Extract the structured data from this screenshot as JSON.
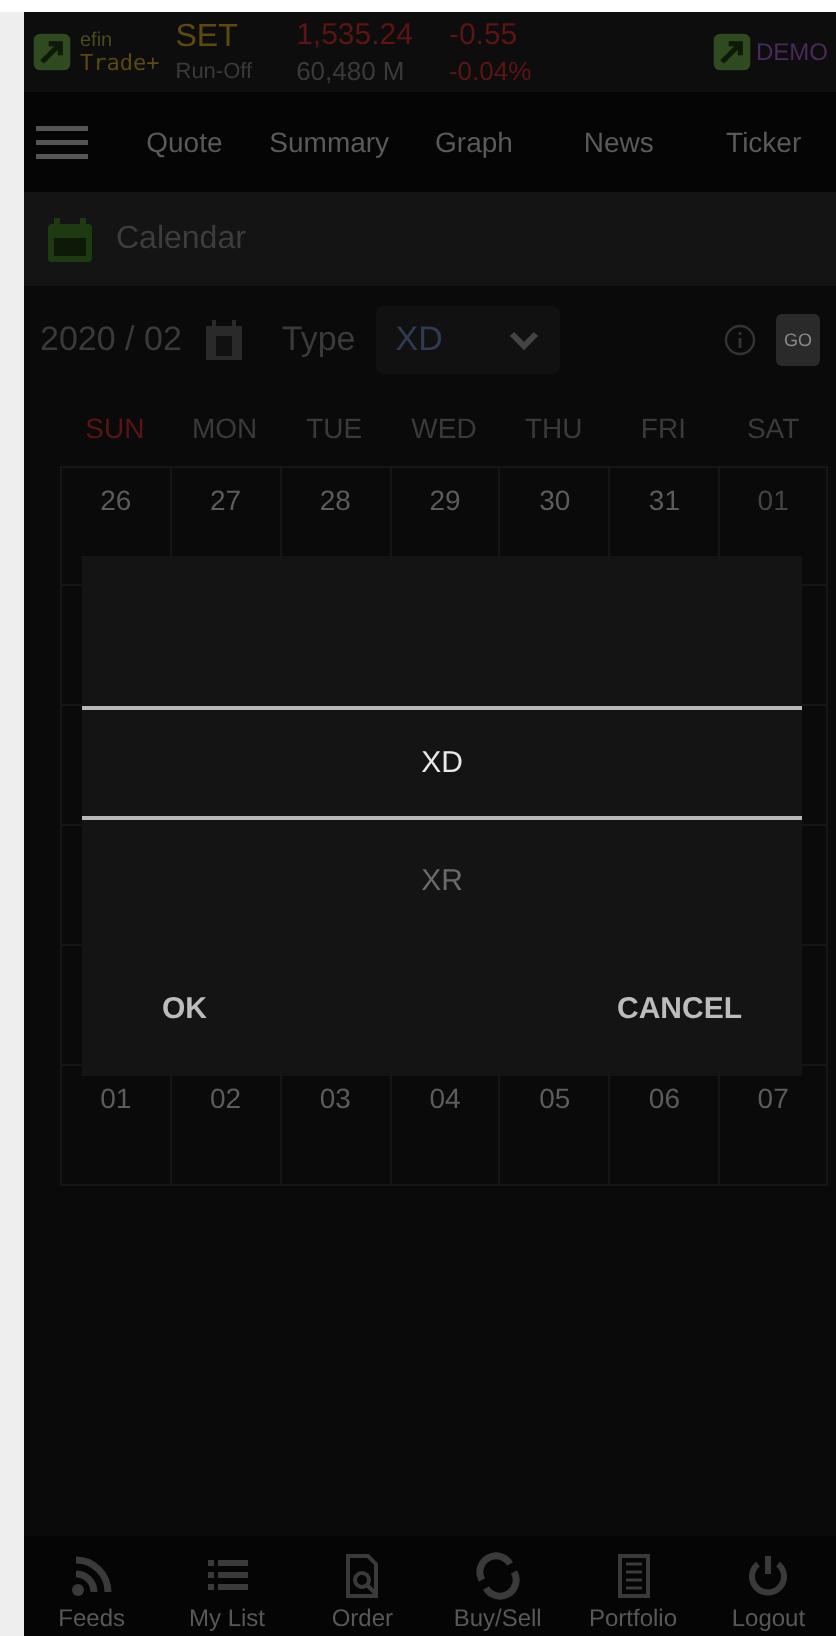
{
  "header": {
    "logo_top": "efin",
    "logo_bottom": "Trade+",
    "index": "SET",
    "value": "1,535.24",
    "change": "-0.55",
    "label": "Run-Off",
    "volume": "60,480 M",
    "percent": "-0.04%",
    "account": "DEMO"
  },
  "tabs": [
    {
      "label": "Quote",
      "selected": false
    },
    {
      "label": "Summary",
      "selected": false
    },
    {
      "label": "Graph",
      "selected": false
    },
    {
      "label": "News",
      "selected": false
    },
    {
      "label": "Ticker",
      "selected": false
    }
  ],
  "page_title": "Calendar",
  "filters": {
    "month": "2020 / 02",
    "type_label": "Type",
    "type_value": "XD",
    "go": "GO"
  },
  "weekdays": [
    {
      "label": "SUN",
      "color": "#5a1414"
    },
    {
      "label": "MON",
      "color": "#3a3a3a"
    },
    {
      "label": "TUE",
      "color": "#3a3a3a"
    },
    {
      "label": "WED",
      "color": "#3a3a3a"
    },
    {
      "label": "THU",
      "color": "#3a3a3a"
    },
    {
      "label": "FRI",
      "color": "#3a3a3a"
    },
    {
      "label": "SAT",
      "color": "#3a3a3a"
    }
  ],
  "weeks": [
    {
      "days": [
        {
          "label": "26",
          "muted": false
        },
        {
          "label": "27",
          "muted": false
        },
        {
          "label": "28",
          "muted": false
        },
        {
          "label": "29",
          "muted": false
        },
        {
          "label": "30",
          "muted": false
        },
        {
          "label": "31",
          "muted": false
        },
        {
          "label": "01",
          "muted": true
        }
      ]
    },
    {
      "days": [
        {
          "label": "01",
          "muted": false
        },
        {
          "label": "02",
          "muted": false
        },
        {
          "label": "03",
          "muted": false
        },
        {
          "label": "04",
          "muted": false
        },
        {
          "label": "05",
          "muted": false
        },
        {
          "label": "06",
          "muted": false
        },
        {
          "label": "07",
          "muted": false
        }
      ]
    }
  ],
  "dialog": {
    "options": [
      {
        "label": "XD",
        "selected": true
      },
      {
        "label": "XR",
        "selected": false
      }
    ],
    "ok": "OK",
    "cancel": "CANCEL"
  },
  "nav": [
    {
      "label": "Feeds",
      "kind": "rss"
    },
    {
      "label": "My List",
      "kind": "list"
    },
    {
      "label": "Order",
      "kind": "document"
    },
    {
      "label": "Buy/Sell",
      "kind": "exchange"
    },
    {
      "label": "Portfolio",
      "kind": "portfolio"
    },
    {
      "label": "Logout",
      "kind": "power"
    }
  ]
}
